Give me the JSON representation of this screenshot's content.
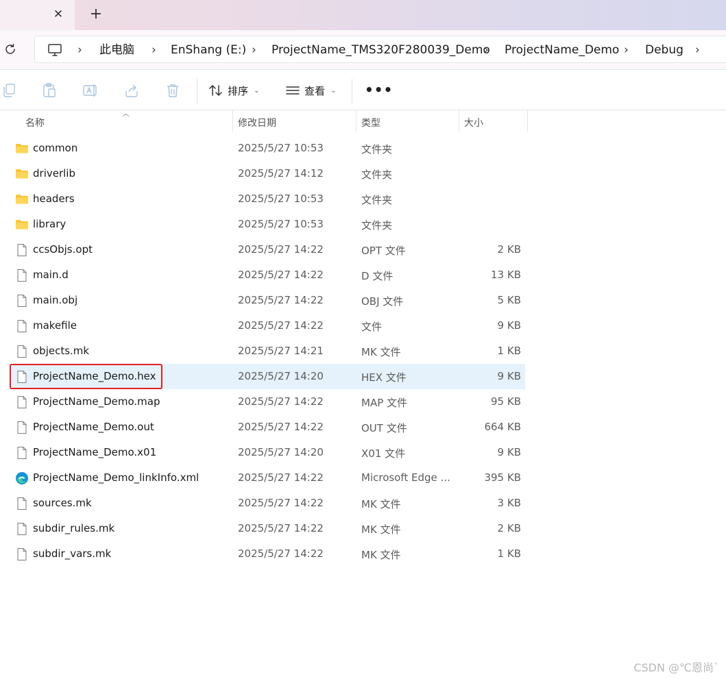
{
  "tabbar": {
    "close_glyph": "✕",
    "new_tab_glyph": "+"
  },
  "address": {
    "crumbs": [
      "此电脑",
      "EnShang (E:)",
      "ProjectName_TMS320F280039_Demo",
      "ProjectName_Demo",
      "Debug"
    ],
    "separator": "›"
  },
  "commandbar": {
    "sort_label": "排序",
    "view_label": "查看",
    "more_label": "•••"
  },
  "columns": {
    "name": "名称",
    "modified": "修改日期",
    "type": "类型",
    "size": "大小"
  },
  "files": [
    {
      "name": "common",
      "modified": "2025/5/27 10:53",
      "type": "文件夹",
      "size": "",
      "icon": "folder-icon"
    },
    {
      "name": "driverlib",
      "modified": "2025/5/27 14:12",
      "type": "文件夹",
      "size": "",
      "icon": "folder-icon"
    },
    {
      "name": "headers",
      "modified": "2025/5/27 10:53",
      "type": "文件夹",
      "size": "",
      "icon": "folder-icon"
    },
    {
      "name": "library",
      "modified": "2025/5/27 10:53",
      "type": "文件夹",
      "size": "",
      "icon": "folder-icon"
    },
    {
      "name": "ccsObjs.opt",
      "modified": "2025/5/27 14:22",
      "type": "OPT 文件",
      "size": "2 KB",
      "icon": "file-icon"
    },
    {
      "name": "main.d",
      "modified": "2025/5/27 14:22",
      "type": "D 文件",
      "size": "13 KB",
      "icon": "file-icon"
    },
    {
      "name": "main.obj",
      "modified": "2025/5/27 14:22",
      "type": "OBJ 文件",
      "size": "5 KB",
      "icon": "file-icon"
    },
    {
      "name": "makefile",
      "modified": "2025/5/27 14:22",
      "type": "文件",
      "size": "9 KB",
      "icon": "file-icon"
    },
    {
      "name": "objects.mk",
      "modified": "2025/5/27 14:21",
      "type": "MK 文件",
      "size": "1 KB",
      "icon": "file-icon"
    },
    {
      "name": "ProjectName_Demo.hex",
      "modified": "2025/5/27 14:20",
      "type": "HEX 文件",
      "size": "9 KB",
      "icon": "file-icon",
      "selected": true
    },
    {
      "name": "ProjectName_Demo.map",
      "modified": "2025/5/27 14:22",
      "type": "MAP 文件",
      "size": "95 KB",
      "icon": "file-icon"
    },
    {
      "name": "ProjectName_Demo.out",
      "modified": "2025/5/27 14:22",
      "type": "OUT 文件",
      "size": "664 KB",
      "icon": "file-icon"
    },
    {
      "name": "ProjectName_Demo.x01",
      "modified": "2025/5/27 14:20",
      "type": "X01 文件",
      "size": "9 KB",
      "icon": "file-icon"
    },
    {
      "name": "ProjectName_Demo_linkInfo.xml",
      "modified": "2025/5/27 14:22",
      "type": "Microsoft Edge ...",
      "size": "395 KB",
      "icon": "edge-icon"
    },
    {
      "name": "sources.mk",
      "modified": "2025/5/27 14:22",
      "type": "MK 文件",
      "size": "3 KB",
      "icon": "file-icon"
    },
    {
      "name": "subdir_rules.mk",
      "modified": "2025/5/27 14:22",
      "type": "MK 文件",
      "size": "2 KB",
      "icon": "file-icon"
    },
    {
      "name": "subdir_vars.mk",
      "modified": "2025/5/27 14:22",
      "type": "MK 文件",
      "size": "1 KB",
      "icon": "file-icon"
    }
  ],
  "colors": {
    "selection": "#e5f1fb",
    "highlight": "#e02020",
    "folder": "#f8c53a"
  },
  "watermark": "CSDN @℃恩尚`"
}
